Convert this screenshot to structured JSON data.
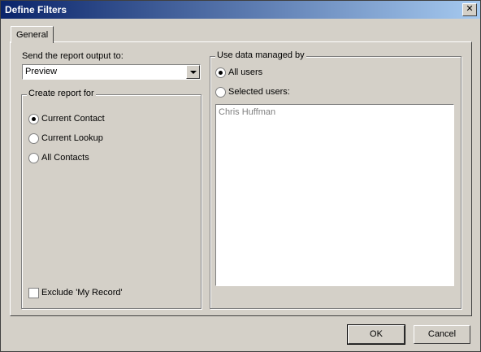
{
  "window": {
    "title": "Define Filters",
    "close_glyph": "✕"
  },
  "tabs": [
    {
      "label": "General"
    }
  ],
  "output": {
    "label": "Send the report output to:",
    "selected": "Preview"
  },
  "create_for": {
    "title": "Create report for",
    "options": [
      {
        "label": "Current Contact",
        "checked": true
      },
      {
        "label": "Current Lookup",
        "checked": false
      },
      {
        "label": "All Contacts",
        "checked": false
      }
    ],
    "exclude_label": "Exclude 'My Record'",
    "exclude_checked": false
  },
  "managed_by": {
    "title": "Use data managed by",
    "options": [
      {
        "label": "All users",
        "checked": true
      },
      {
        "label": "Selected users:",
        "checked": false
      }
    ],
    "users": [
      "Chris Huffman"
    ]
  },
  "buttons": {
    "ok": "OK",
    "cancel": "Cancel"
  }
}
